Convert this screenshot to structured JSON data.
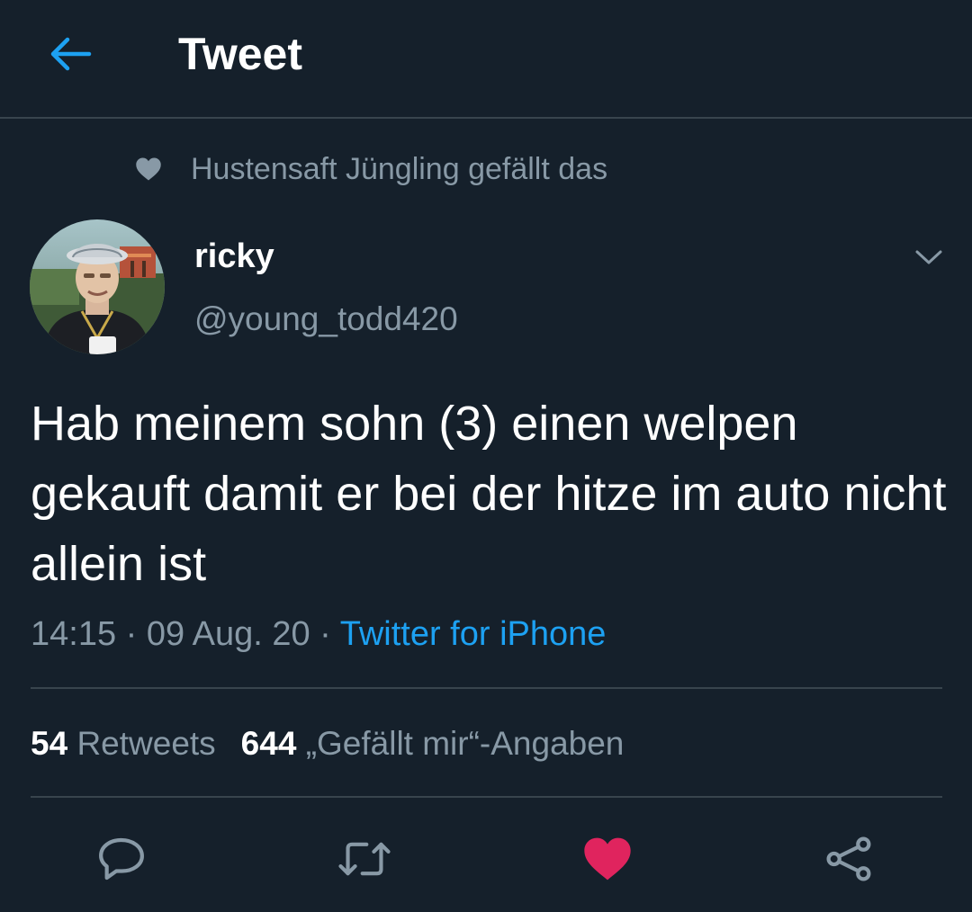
{
  "header": {
    "title": "Tweet",
    "back_icon": "back-arrow-icon"
  },
  "social_context": {
    "icon": "heart-icon",
    "text": "Hustensaft Jüngling gefällt das"
  },
  "author": {
    "name": "ricky",
    "handle": "@young_todd420",
    "menu_icon": "chevron-down-icon"
  },
  "tweet": {
    "text": "Hab meinem sohn (3) einen welpen gekauft damit er bei der hitze im auto nicht allein ist",
    "time": "14:15",
    "separator": "·",
    "date": "09 Aug. 20",
    "source": "Twitter for iPhone"
  },
  "stats": {
    "retweets_count": "54",
    "retweets_label": "Retweets",
    "likes_count": "644",
    "likes_label": "„Gefällt mir“-Angaben"
  },
  "actions": [
    {
      "name": "reply",
      "icon": "reply-icon"
    },
    {
      "name": "retweet",
      "icon": "retweet-icon"
    },
    {
      "name": "like",
      "icon": "heart-icon",
      "active": true
    },
    {
      "name": "share",
      "icon": "share-icon"
    }
  ],
  "colors": {
    "background": "#15202b",
    "divider": "#38444d",
    "secondary_text": "#8899a6",
    "accent": "#1da1f2",
    "like_active": "#e0245e"
  }
}
